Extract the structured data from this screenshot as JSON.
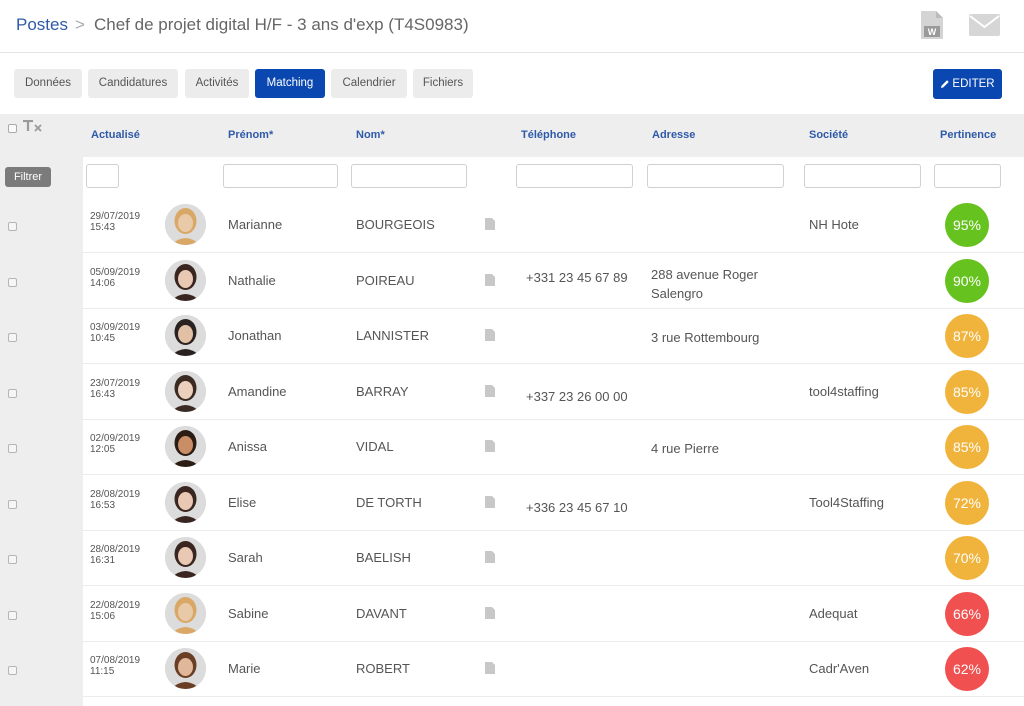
{
  "breadcrumb": {
    "root": "Postes",
    "separator": ">",
    "title": "Chef de projet digital H/F - 3 ans d'exp (T4S0983)"
  },
  "tabs": [
    {
      "label": "Données",
      "active": false
    },
    {
      "label": "Candidatures",
      "active": false
    },
    {
      "label": "Activités",
      "active": false
    },
    {
      "label": "Matching",
      "active": true
    },
    {
      "label": "Calendrier",
      "active": false
    },
    {
      "label": "Fichiers",
      "active": false
    }
  ],
  "edit_button": "EDITER",
  "filter_button": "Filtrer",
  "columns": {
    "actualise": "Actualisé",
    "prenom": "Prénom*",
    "nom": "Nom*",
    "telephone": "Téléphone",
    "adresse": "Adresse",
    "societe": "Société",
    "pertinence": "Pertinence"
  },
  "colors": {
    "accent": "#0a47b0",
    "link": "#2f5aa8",
    "score_high": "#66c21e",
    "score_mid": "#f0b43c",
    "score_low": "#f0504f"
  },
  "rows": [
    {
      "date": "29/07/2019",
      "time": "15:43",
      "prenom": "Marianne",
      "nom": "BOURGEOIS",
      "telephone": "",
      "adresse": "",
      "adresse2": "",
      "societe": "NH Hote",
      "score": "95%",
      "level": "high",
      "avatar": "woman-blonde"
    },
    {
      "date": "05/09/2019",
      "time": "14:06",
      "prenom": "Nathalie",
      "nom": "POIREAU",
      "telephone": "+331 23 45 67 89",
      "adresse": "288 avenue Roger",
      "adresse2": "Salengro",
      "societe": "",
      "score": "90%",
      "level": "high",
      "avatar": "woman-dark"
    },
    {
      "date": "03/09/2019",
      "time": "10:45",
      "prenom": "Jonathan",
      "nom": "LANNISTER",
      "telephone": "",
      "adresse": "3 rue Rottembourg",
      "adresse2": "",
      "societe": "",
      "score": "87%",
      "level": "mid",
      "avatar": "man"
    },
    {
      "date": "23/07/2019",
      "time": "16:43",
      "prenom": "Amandine",
      "nom": "BARRAY",
      "telephone": "+337 23 26 00 00",
      "adresse": "",
      "adresse2": "",
      "societe": "tool4staffing",
      "score": "85%",
      "level": "mid",
      "avatar": "woman-glasses"
    },
    {
      "date": "02/09/2019",
      "time": "12:05",
      "prenom": "Anissa",
      "nom": "VIDAL",
      "telephone": "",
      "adresse": "4 rue Pierre",
      "adresse2": "",
      "societe": "",
      "score": "85%",
      "level": "mid",
      "avatar": "woman-curly"
    },
    {
      "date": "28/08/2019",
      "time": "16:53",
      "prenom": "Elise",
      "nom": "DE TORTH",
      "telephone": "+336 23 45 67 10",
      "adresse": "",
      "adresse2": "",
      "societe": "Tool4Staffing",
      "score": "72%",
      "level": "mid",
      "avatar": "woman-dark"
    },
    {
      "date": "28/08/2019",
      "time": "16:31",
      "prenom": "Sarah",
      "nom": "BAELISH",
      "telephone": "",
      "adresse": "",
      "adresse2": "",
      "societe": "",
      "score": "70%",
      "level": "mid",
      "avatar": "woman-dark"
    },
    {
      "date": "22/08/2019",
      "time": "15:06",
      "prenom": "Sabine",
      "nom": "DAVANT",
      "telephone": "",
      "adresse": "",
      "adresse2": "",
      "societe": "Adequat",
      "score": "66%",
      "level": "low",
      "avatar": "woman-blonde"
    },
    {
      "date": "07/08/2019",
      "time": "11:15",
      "prenom": "Marie",
      "nom": "ROBERT",
      "telephone": "",
      "adresse": "",
      "adresse2": "",
      "societe": "Cadr'Aven",
      "score": "62%",
      "level": "low",
      "avatar": "woman-brown"
    }
  ]
}
